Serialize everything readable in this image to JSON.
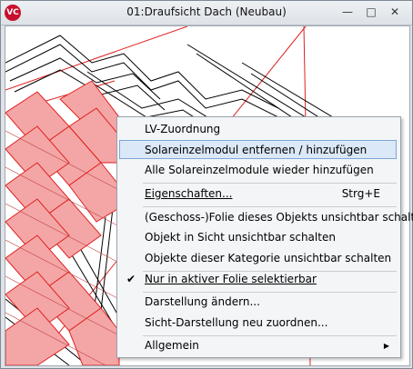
{
  "window": {
    "title": "01:Draufsicht Dach (Neubau)",
    "app_icon": "vc-logo",
    "controls": {
      "minimize": "—",
      "maximize": "□",
      "close": "✕"
    }
  },
  "colors": {
    "roof_fill": "#f4a6a6",
    "roof_line": "#e02020",
    "structure_line": "#000000",
    "menu_highlight": "#dbe8f7"
  },
  "context_menu": {
    "items": [
      {
        "label": "LV-Zuordnung"
      },
      {
        "label": "Solareinzelmodul entfernen / hinzufügen",
        "highlighted": true
      },
      {
        "label": "Alle Solareinzelmodule wieder hinzufügen"
      },
      {
        "label": "Eigenschaften...",
        "shortcut": "Strg+E"
      },
      {
        "label": "(Geschoss-)Folie dieses Objekts unsichtbar schalten"
      },
      {
        "label": "Objekt in Sicht unsichtbar schalten"
      },
      {
        "label": "Objekte dieser Kategorie unsichtbar schalten"
      },
      {
        "label": "Nur in aktiver Folie selektierbar",
        "checked": true,
        "check_icon": "✔"
      },
      {
        "label": "Darstellung ändern..."
      },
      {
        "label": "Sicht-Darstellung neu zuordnen..."
      },
      {
        "label": "Allgemein",
        "submenu_arrow": "▶"
      }
    ]
  }
}
